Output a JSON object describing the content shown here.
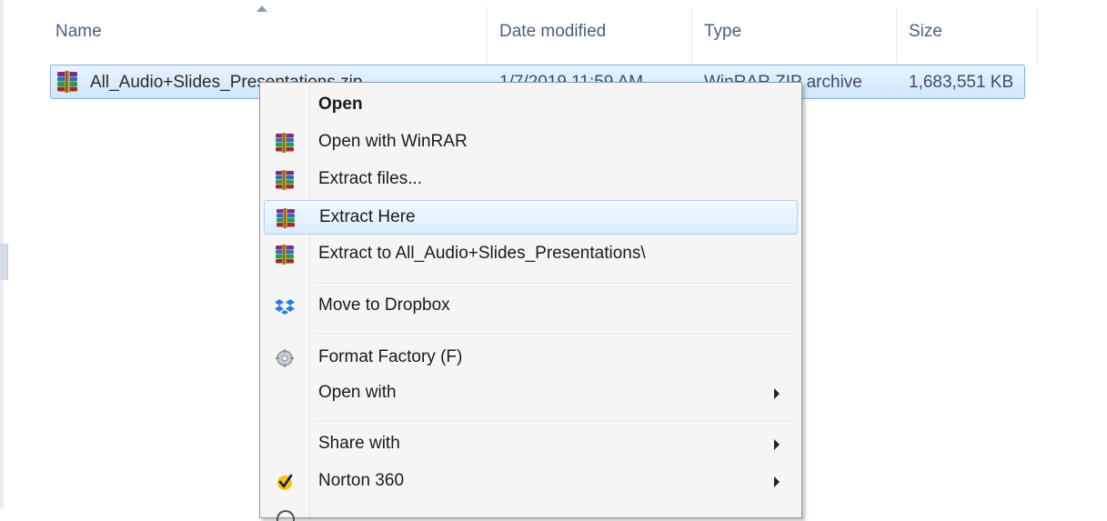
{
  "columns": {
    "name": "Name",
    "date_modified": "Date modified",
    "type": "Type",
    "size": "Size"
  },
  "file": {
    "name": "All_Audio+Slides_Presentations.zip",
    "date_modified": "1/7/2019 11:59 AM",
    "type": "WinRAR ZIP archive",
    "size": "1,683,551 KB",
    "icon": "winrar-archive-icon"
  },
  "menu": {
    "items": [
      {
        "label": "Open",
        "icon": "",
        "bold": true
      },
      {
        "label": "Open with WinRAR",
        "icon": "winrar-icon"
      },
      {
        "label": "Extract files...",
        "icon": "winrar-icon"
      },
      {
        "label": "Extract Here",
        "icon": "winrar-icon",
        "highlighted": true
      },
      {
        "label": "Extract to All_Audio+Slides_Presentations\\",
        "icon": "winrar-icon"
      },
      {
        "label": "Move to Dropbox",
        "icon": "dropbox-icon"
      },
      {
        "label": "Format Factory (F)",
        "icon": "format-factory-icon"
      },
      {
        "label": "Open with",
        "icon": "",
        "submenu": true
      },
      {
        "label": "Share with",
        "icon": "",
        "submenu": true
      },
      {
        "label": "Norton 360",
        "icon": "norton-icon",
        "submenu": true
      }
    ]
  },
  "colors": {
    "selection": "#cfe6fc",
    "selection_border": "#84acdd",
    "menu_bg": "#f5f5f5",
    "header_text": "#4c607a"
  }
}
